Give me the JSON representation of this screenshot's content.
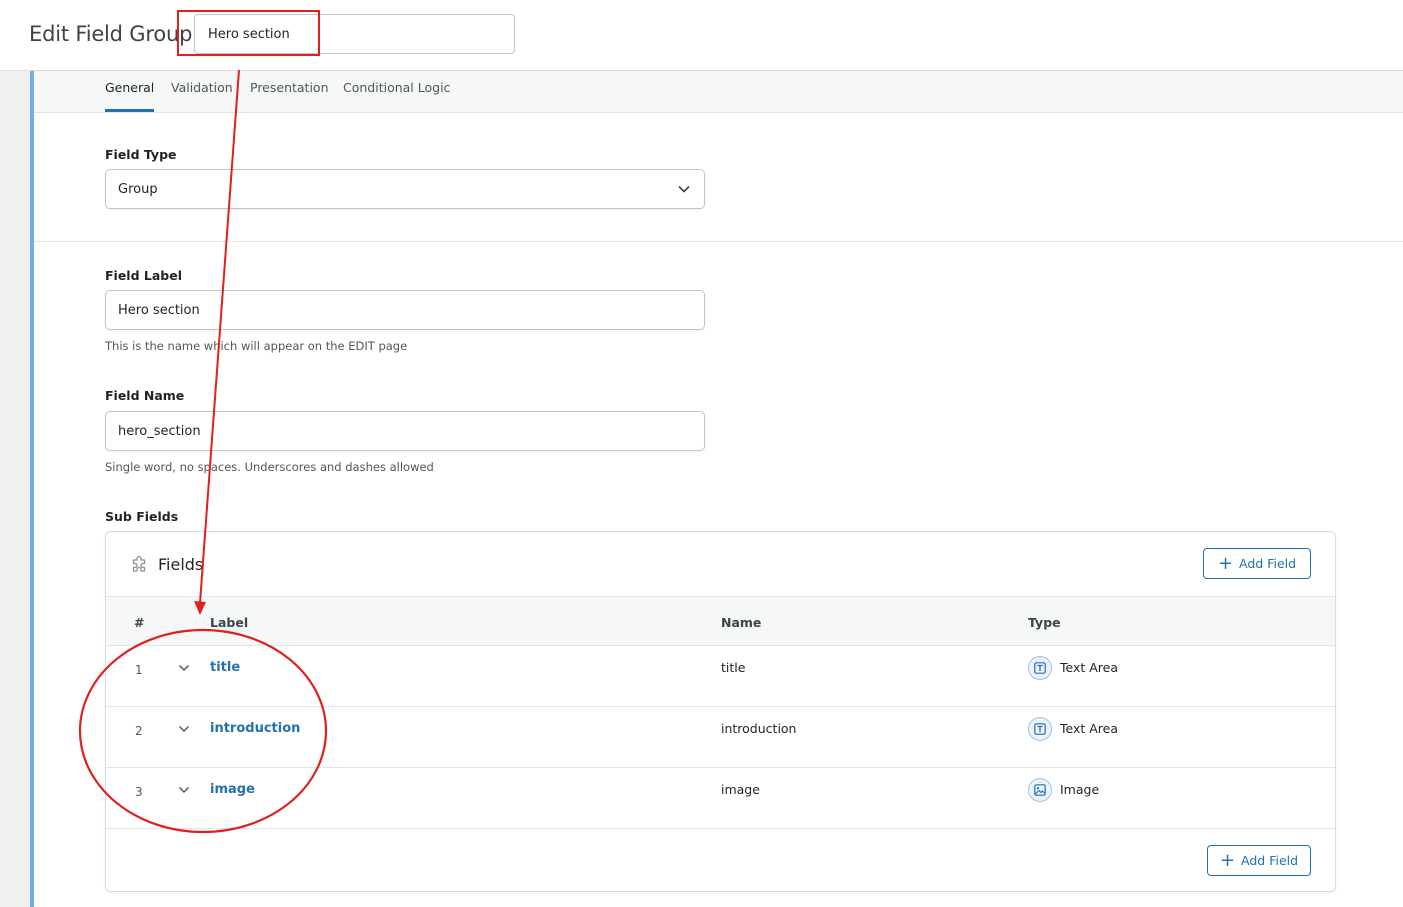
{
  "header": {
    "title": "Edit Field Group",
    "group_title_value": "Hero section"
  },
  "tabs": [
    {
      "label": "General",
      "active": true
    },
    {
      "label": "Validation",
      "active": false
    },
    {
      "label": "Presentation",
      "active": false
    },
    {
      "label": "Conditional Logic",
      "active": false
    }
  ],
  "general": {
    "field_type": {
      "label": "Field Type",
      "value": "Group"
    },
    "field_label": {
      "label": "Field Label",
      "value": "Hero section",
      "help": "This is the name which will appear on the EDIT page"
    },
    "field_name": {
      "label": "Field Name",
      "value": "hero_section",
      "help": "Single word, no spaces. Underscores and dashes allowed"
    }
  },
  "sub_fields": {
    "label": "Sub Fields",
    "panel_title": "Fields",
    "add_button": "Add Field",
    "columns": [
      "#",
      "Label",
      "Name",
      "Type"
    ],
    "rows": [
      {
        "num": "1",
        "label": "title",
        "name": "title",
        "type": "Text Area",
        "icon": "text-area-icon"
      },
      {
        "num": "2",
        "label": "introduction",
        "name": "introduction",
        "type": "Text Area",
        "icon": "text-area-icon"
      },
      {
        "num": "3",
        "label": "image",
        "name": "image",
        "type": "Image",
        "icon": "image-icon"
      }
    ]
  },
  "colors": {
    "accent": "#2271b1",
    "annotation": "#e0201b",
    "left_bar": "#72aee6"
  }
}
